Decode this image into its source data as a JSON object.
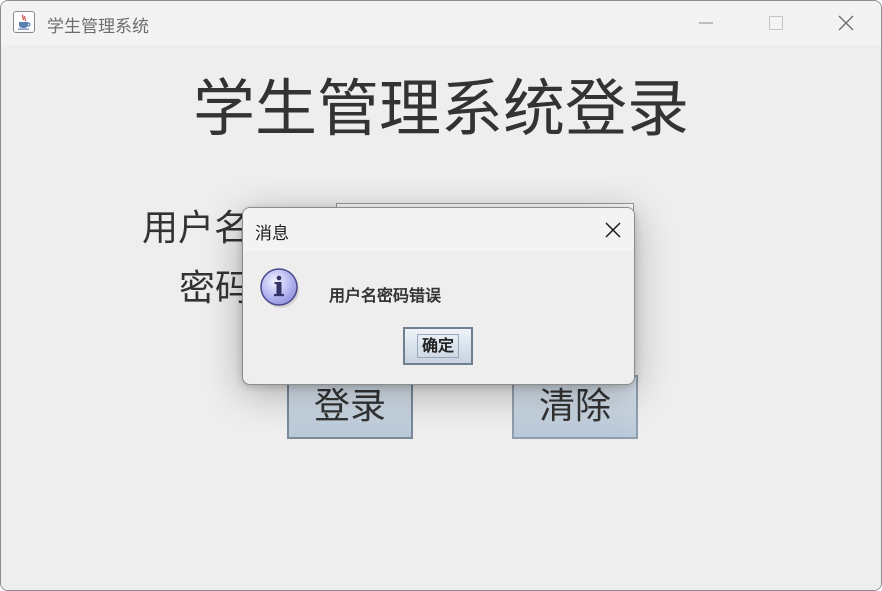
{
  "window": {
    "title": "学生管理系统",
    "icons": {
      "app": "java-cup-icon",
      "minimize": "minimize-icon",
      "maximize": "maximize-icon",
      "close": "close-icon"
    }
  },
  "form": {
    "heading": "学生管理系统登录",
    "username_label": "用户名",
    "password_label": "密码",
    "username_value": "",
    "password_value": "",
    "login_button": "登录",
    "clear_button": "清除"
  },
  "dialog": {
    "title": "消息",
    "message": "用户名密码错误",
    "ok_button": "确定",
    "icon": "info-icon",
    "close_icon": "close-icon"
  },
  "colors": {
    "background": "#eeeeee",
    "titlebar": "#f3f3f3",
    "button_gradient_top": "#dde6ef",
    "button_gradient_bottom": "#b9c8d7",
    "info_icon": "#aaaaee"
  }
}
